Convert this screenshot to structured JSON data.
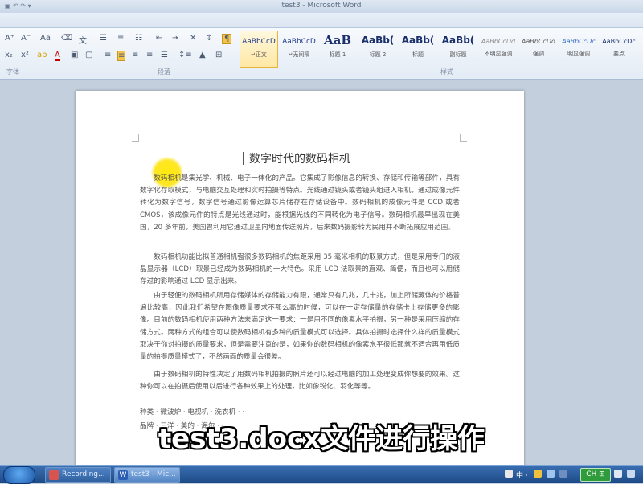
{
  "window": {
    "title": "test3 - Microsoft Word"
  },
  "ribbon": {
    "font_row": [
      "A",
      "A",
      "Aa",
      "A",
      "⁻",
      "x₂",
      "x²",
      "A"
    ],
    "group_labels": {
      "font": "字体",
      "paragraph": "段落",
      "styles": "样式"
    },
    "styles": [
      {
        "sample": "AaBbCcD",
        "name": "↵正文"
      },
      {
        "sample": "AaBbCcD",
        "name": "↵无间隔"
      },
      {
        "sample": "AaB",
        "name": "标题 1"
      },
      {
        "sample": "AaBb(",
        "name": "标题 2"
      },
      {
        "sample": "AaBb(",
        "name": "标题"
      },
      {
        "sample": "AaBb(",
        "name": "副标题"
      },
      {
        "sample": "AaBbCcDd",
        "name": "不明显强调"
      },
      {
        "sample": "AaBbCcDd",
        "name": "强调"
      },
      {
        "sample": "AaBbCcDc",
        "name": "明显强调"
      },
      {
        "sample": "AaBbCcDc",
        "name": "要点"
      }
    ]
  },
  "document": {
    "title": "数字时代的数码相机",
    "paragraphs": [
      "数码相机是集光学、机械、电子一体化的产品。它集成了影像信息的转换、存储和传输等部件，具有数字化存取模式，与电脑交互处理和实时拍摄等特点。光线通过镜头或者镜头组进入相机，通过成像元件转化为数字信号，数字信号通过影像运算芯片储存在存储设备中。数码相机的成像元件是 CCD 或者 CMOS，该成像元件的特点是光线通过时，能根据光线的不同转化为电子信号。数码相机最早出现在美国，20 多年前，美国曾利用它通过卫星向地面传送照片，后来数码摄影转为民用并不断拓展应用范围。",
      "数码相机功能比拟普通相机强很多数码相机的焦距采用 35 毫米相机的取景方式，但是采用专门的液晶显示器（LCD）取景已经成为数码相机的一大特色。采用 LCD 法取景的直观、简便，而且也可以用储存过的影响通过 LCD 显示出来。",
      "由于轻便的数码相机所用存储媒体的存储能力有限，通常只有几兆，几十兆，加上所储藏体的价格普遍比较高，因此我们希望在图像质量要求不那么高的时候，可以在一定存储量的存储卡上存储更多的影像。目前的数码相机使用两种方法来满足这一要求：一是用不同的像素水平拍摄，另一种是采用压缩的存储方式。两种方式的组合可以使数码相机有多种的质量模式可以选择。具体拍摄时选择什么样的质量模式取决于你对拍摄的质量要求，但是需要注意的是，如果你的数码相机的像素水平很低那就不适合再用低质量的拍摄质量模式了，不然画面的质量会很差。",
      "由于数码相机的特性决定了用数码相机拍摄的照片还可以经过电脑的加工处理变成你想要的效果。这种你可以在拍摄后使用以后进行各种效果上的处理，比如像锐化、羽化等等。"
    ],
    "list_rows": [
      "种类  ·  微波炉 · 电视机 · 洗衣机 · ·",
      "品牌  ·  三洋 · 美的 · 海尔 · ·"
    ]
  },
  "caption": "test3.docx文件进行操作",
  "taskbar": {
    "buttons": [
      {
        "label": "Recording...",
        "color": "#d9534f"
      },
      {
        "label": "test3 - Mic...",
        "color": "#2b5fb4"
      }
    ],
    "lang_badge": "CH ⊞",
    "tray_text": "中 ·",
    "clock": ""
  }
}
